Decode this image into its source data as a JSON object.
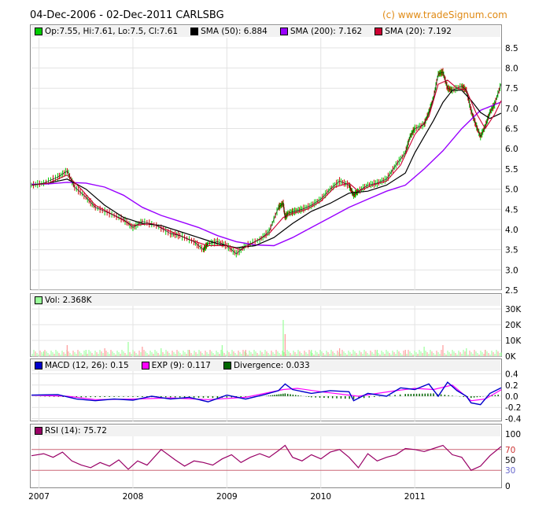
{
  "header": {
    "title": "04-Dec-2006 - 02-Dec-2011 CARLSBG",
    "credit": "(c) www.tradeSignum.com"
  },
  "colors": {
    "price_up": "#00cc00",
    "price_down": "#cc0000",
    "sma50": "#000000",
    "sma200": "#9900ff",
    "sma20": "#cc0033",
    "volume_up": "#99ff99",
    "volume_down": "#ff9999",
    "macd": "#0000cc",
    "exp": "#ff00ff",
    "divergence": "#006600",
    "rsi": "#990066",
    "rsi_band": "#cc6677",
    "rsi_30": "#6666cc",
    "rsi_70": "#cc3333"
  },
  "legends": {
    "price": [
      {
        "key": "ohlc",
        "text": "Op:7.55, Hi:7.61, Lo:7.5, Cl:7.61",
        "color": "#00cc00"
      },
      {
        "key": "sma50",
        "text": "SMA (50): 6.884",
        "color": "#000000"
      },
      {
        "key": "sma200",
        "text": "SMA (200): 7.162",
        "color": "#9900ff"
      },
      {
        "key": "sma20",
        "text": "SMA (20): 7.192",
        "color": "#cc0033"
      }
    ],
    "volume": [
      {
        "key": "vol",
        "text": "Vol: 2.368K",
        "color": "#99ff99"
      }
    ],
    "macd": [
      {
        "key": "macd",
        "text": "MACD (12, 26): 0.15",
        "color": "#0000cc"
      },
      {
        "key": "exp",
        "text": "EXP (9): 0.117",
        "color": "#ff00ff"
      },
      {
        "key": "div",
        "text": "Divergence: 0.033",
        "color": "#006600"
      }
    ],
    "rsi": [
      {
        "key": "rsi",
        "text": "RSI (14): 75.72",
        "color": "#990066"
      }
    ]
  },
  "axes": {
    "price_ticks": [
      "8.5",
      "8.0",
      "7.5",
      "7.0",
      "6.5",
      "6.0",
      "5.5",
      "5.0",
      "4.5",
      "4.0",
      "3.5",
      "3.0",
      "2.5"
    ],
    "volume_ticks": [
      "30K",
      "20K",
      "10K",
      "0K"
    ],
    "macd_ticks": [
      "0.4",
      "0.2",
      "0.0",
      "-0.2",
      "-0.4"
    ],
    "rsi_ticks": [
      "100",
      "70",
      "50",
      "30",
      "0"
    ],
    "x_ticks": [
      "2007",
      "2008",
      "2009",
      "2010",
      "2011"
    ]
  },
  "chart_data": [
    {
      "type": "line",
      "panel": "price",
      "x_range": [
        2006.92,
        2011.92
      ],
      "ylim": [
        2.5,
        8.75
      ],
      "grid": true,
      "series": [
        {
          "name": "Close",
          "x": [
            2006.92,
            2007.05,
            2007.2,
            2007.3,
            2007.38,
            2007.5,
            2007.6,
            2007.75,
            2007.9,
            2008.0,
            2008.1,
            2008.25,
            2008.4,
            2008.5,
            2008.65,
            2008.75,
            2008.8,
            2008.9,
            2009.0,
            2009.1,
            2009.2,
            2009.35,
            2009.45,
            2009.55,
            2009.6,
            2009.62,
            2009.65,
            2009.72,
            2009.8,
            2009.9,
            2010.0,
            2010.1,
            2010.2,
            2010.3,
            2010.35,
            2010.4,
            2010.5,
            2010.6,
            2010.7,
            2010.8,
            2010.9,
            2010.95,
            2011.0,
            2011.1,
            2011.15,
            2011.2,
            2011.25,
            2011.3,
            2011.35,
            2011.4,
            2011.5,
            2011.55,
            2011.6,
            2011.65,
            2011.7,
            2011.75,
            2011.8,
            2011.85,
            2011.92
          ],
          "y": [
            5.1,
            5.15,
            5.3,
            5.45,
            5.05,
            4.8,
            4.55,
            4.4,
            4.25,
            4.05,
            4.2,
            4.1,
            3.9,
            3.85,
            3.7,
            3.5,
            3.65,
            3.7,
            3.6,
            3.4,
            3.6,
            3.75,
            3.95,
            4.55,
            4.65,
            4.3,
            4.4,
            4.45,
            4.5,
            4.6,
            4.75,
            5.0,
            5.2,
            5.1,
            4.85,
            4.95,
            5.1,
            5.15,
            5.25,
            5.6,
            5.9,
            6.3,
            6.5,
            6.6,
            6.9,
            7.25,
            7.85,
            7.9,
            7.5,
            7.45,
            7.55,
            7.45,
            6.95,
            6.6,
            6.3,
            6.55,
            6.9,
            7.1,
            7.61
          ]
        },
        {
          "name": "SMA (20)",
          "x": [
            2006.92,
            2007.1,
            2007.3,
            2007.45,
            2007.6,
            2007.8,
            2008.0,
            2008.2,
            2008.4,
            2008.6,
            2008.8,
            2009.0,
            2009.15,
            2009.3,
            2009.45,
            2009.6,
            2009.7,
            2009.85,
            2010.0,
            2010.15,
            2010.3,
            2010.4,
            2010.55,
            2010.7,
            2010.85,
            2011.0,
            2011.15,
            2011.25,
            2011.35,
            2011.45,
            2011.55,
            2011.65,
            2011.75,
            2011.85,
            2011.92
          ],
          "y": [
            5.1,
            5.15,
            5.35,
            5.0,
            4.6,
            4.35,
            4.1,
            4.15,
            3.95,
            3.75,
            3.6,
            3.6,
            3.5,
            3.7,
            3.9,
            4.3,
            4.4,
            4.5,
            4.7,
            5.05,
            5.15,
            4.95,
            5.1,
            5.2,
            5.6,
            6.35,
            6.8,
            7.6,
            7.7,
            7.5,
            7.45,
            6.9,
            6.5,
            6.85,
            7.19
          ]
        },
        {
          "name": "SMA (50)",
          "x": [
            2006.92,
            2007.1,
            2007.3,
            2007.5,
            2007.7,
            2007.9,
            2008.1,
            2008.3,
            2008.5,
            2008.7,
            2008.9,
            2009.1,
            2009.3,
            2009.5,
            2009.7,
            2009.9,
            2010.1,
            2010.3,
            2010.5,
            2010.7,
            2010.9,
            2011.0,
            2011.1,
            2011.2,
            2011.3,
            2011.4,
            2011.5,
            2011.6,
            2011.7,
            2011.8,
            2011.92
          ],
          "y": [
            5.1,
            5.15,
            5.25,
            5.0,
            4.6,
            4.3,
            4.15,
            4.1,
            3.95,
            3.8,
            3.65,
            3.55,
            3.6,
            3.8,
            4.15,
            4.45,
            4.65,
            4.9,
            4.95,
            5.1,
            5.4,
            5.9,
            6.3,
            6.7,
            7.15,
            7.45,
            7.45,
            7.2,
            6.9,
            6.75,
            6.88
          ]
        },
        {
          "name": "SMA (200)",
          "x": [
            2006.92,
            2007.1,
            2007.3,
            2007.5,
            2007.7,
            2007.9,
            2008.1,
            2008.3,
            2008.5,
            2008.7,
            2008.9,
            2009.1,
            2009.3,
            2009.5,
            2009.7,
            2009.9,
            2010.1,
            2010.3,
            2010.5,
            2010.7,
            2010.9,
            2011.1,
            2011.3,
            2011.5,
            2011.7,
            2011.92
          ],
          "y": [
            5.12,
            5.13,
            5.17,
            5.15,
            5.05,
            4.85,
            4.55,
            4.35,
            4.2,
            4.05,
            3.85,
            3.7,
            3.62,
            3.6,
            3.8,
            4.05,
            4.3,
            4.55,
            4.75,
            4.95,
            5.1,
            5.5,
            5.95,
            6.5,
            6.95,
            7.16
          ]
        }
      ]
    },
    {
      "type": "bar",
      "panel": "volume",
      "ylim": [
        0,
        32000
      ],
      "series": [
        {
          "name": "Vol",
          "x": [
            2007.05,
            2007.3,
            2007.5,
            2007.7,
            2007.95,
            2008.1,
            2008.3,
            2008.6,
            2008.95,
            2009.2,
            2009.6,
            2009.62,
            2009.9,
            2010.2,
            2010.6,
            2010.9,
            2011.1,
            2011.3,
            2011.55,
            2011.75,
            2011.92
          ],
          "y": [
            3000,
            7000,
            4000,
            5000,
            9000,
            6000,
            5000,
            4000,
            7000,
            4000,
            23000,
            14000,
            4000,
            5000,
            4000,
            4000,
            6000,
            7000,
            5000,
            4000,
            2368
          ]
        }
      ]
    },
    {
      "type": "line",
      "panel": "macd",
      "ylim": [
        -0.45,
        0.45
      ],
      "series": [
        {
          "name": "MACD (12, 26)",
          "x": [
            2006.92,
            2007.2,
            2007.4,
            2007.6,
            2007.8,
            2008.0,
            2008.2,
            2008.4,
            2008.6,
            2008.8,
            2009.0,
            2009.2,
            2009.4,
            2009.55,
            2009.62,
            2009.7,
            2009.9,
            2010.1,
            2010.3,
            2010.35,
            2010.5,
            2010.7,
            2010.85,
            2011.0,
            2011.15,
            2011.25,
            2011.35,
            2011.45,
            2011.55,
            2011.6,
            2011.7,
            2011.8,
            2011.92
          ],
          "y": [
            0.02,
            0.03,
            -0.05,
            -0.08,
            -0.05,
            -0.07,
            0.0,
            -0.05,
            -0.02,
            -0.1,
            0.02,
            -0.05,
            0.03,
            0.1,
            0.22,
            0.12,
            0.05,
            0.1,
            0.08,
            -0.08,
            0.05,
            0.0,
            0.15,
            0.12,
            0.22,
            0.0,
            0.25,
            0.1,
            0.0,
            -0.12,
            -0.15,
            0.05,
            0.15
          ]
        },
        {
          "name": "EXP (9)",
          "x": [
            2006.92,
            2007.3,
            2007.6,
            2008.0,
            2008.4,
            2008.8,
            2009.2,
            2009.6,
            2009.75,
            2010.0,
            2010.4,
            2010.8,
            2011.0,
            2011.2,
            2011.4,
            2011.6,
            2011.75,
            2011.92
          ],
          "y": [
            0.02,
            0.0,
            -0.06,
            -0.05,
            -0.03,
            -0.06,
            -0.02,
            0.12,
            0.14,
            0.08,
            0.0,
            0.1,
            0.14,
            0.12,
            0.2,
            -0.08,
            -0.05,
            0.117
          ]
        },
        {
          "name": "Divergence",
          "x": [
            2006.92,
            2007.4,
            2007.9,
            2008.4,
            2008.9,
            2009.4,
            2009.62,
            2009.9,
            2010.35,
            2010.9,
            2011.2,
            2011.6,
            2011.92
          ],
          "y": [
            0.0,
            -0.02,
            -0.01,
            -0.02,
            -0.03,
            0.0,
            0.05,
            -0.02,
            -0.05,
            0.04,
            0.05,
            -0.03,
            0.033
          ]
        }
      ]
    },
    {
      "type": "line",
      "panel": "rsi",
      "ylim": [
        0,
        100
      ],
      "series": [
        {
          "name": "RSI (14)",
          "x": [
            2006.92,
            2007.05,
            2007.15,
            2007.25,
            2007.35,
            2007.45,
            2007.55,
            2007.65,
            2007.75,
            2007.85,
            2007.95,
            2008.05,
            2008.15,
            2008.3,
            2008.45,
            2008.55,
            2008.65,
            2008.75,
            2008.85,
            2008.95,
            2009.05,
            2009.15,
            2009.25,
            2009.35,
            2009.45,
            2009.55,
            2009.62,
            2009.7,
            2009.8,
            2009.9,
            2010.0,
            2010.1,
            2010.2,
            2010.3,
            2010.4,
            2010.5,
            2010.6,
            2010.7,
            2010.8,
            2010.9,
            2011.0,
            2011.1,
            2011.2,
            2011.3,
            2011.4,
            2011.5,
            2011.6,
            2011.7,
            2011.8,
            2011.92
          ],
          "y": [
            58,
            62,
            55,
            65,
            48,
            40,
            35,
            45,
            38,
            50,
            32,
            48,
            40,
            70,
            50,
            38,
            48,
            45,
            40,
            52,
            60,
            45,
            55,
            62,
            55,
            68,
            78,
            55,
            48,
            60,
            52,
            65,
            70,
            55,
            35,
            62,
            48,
            55,
            60,
            72,
            70,
            66,
            72,
            78,
            60,
            55,
            30,
            38,
            58,
            75.72
          ]
        }
      ]
    }
  ]
}
